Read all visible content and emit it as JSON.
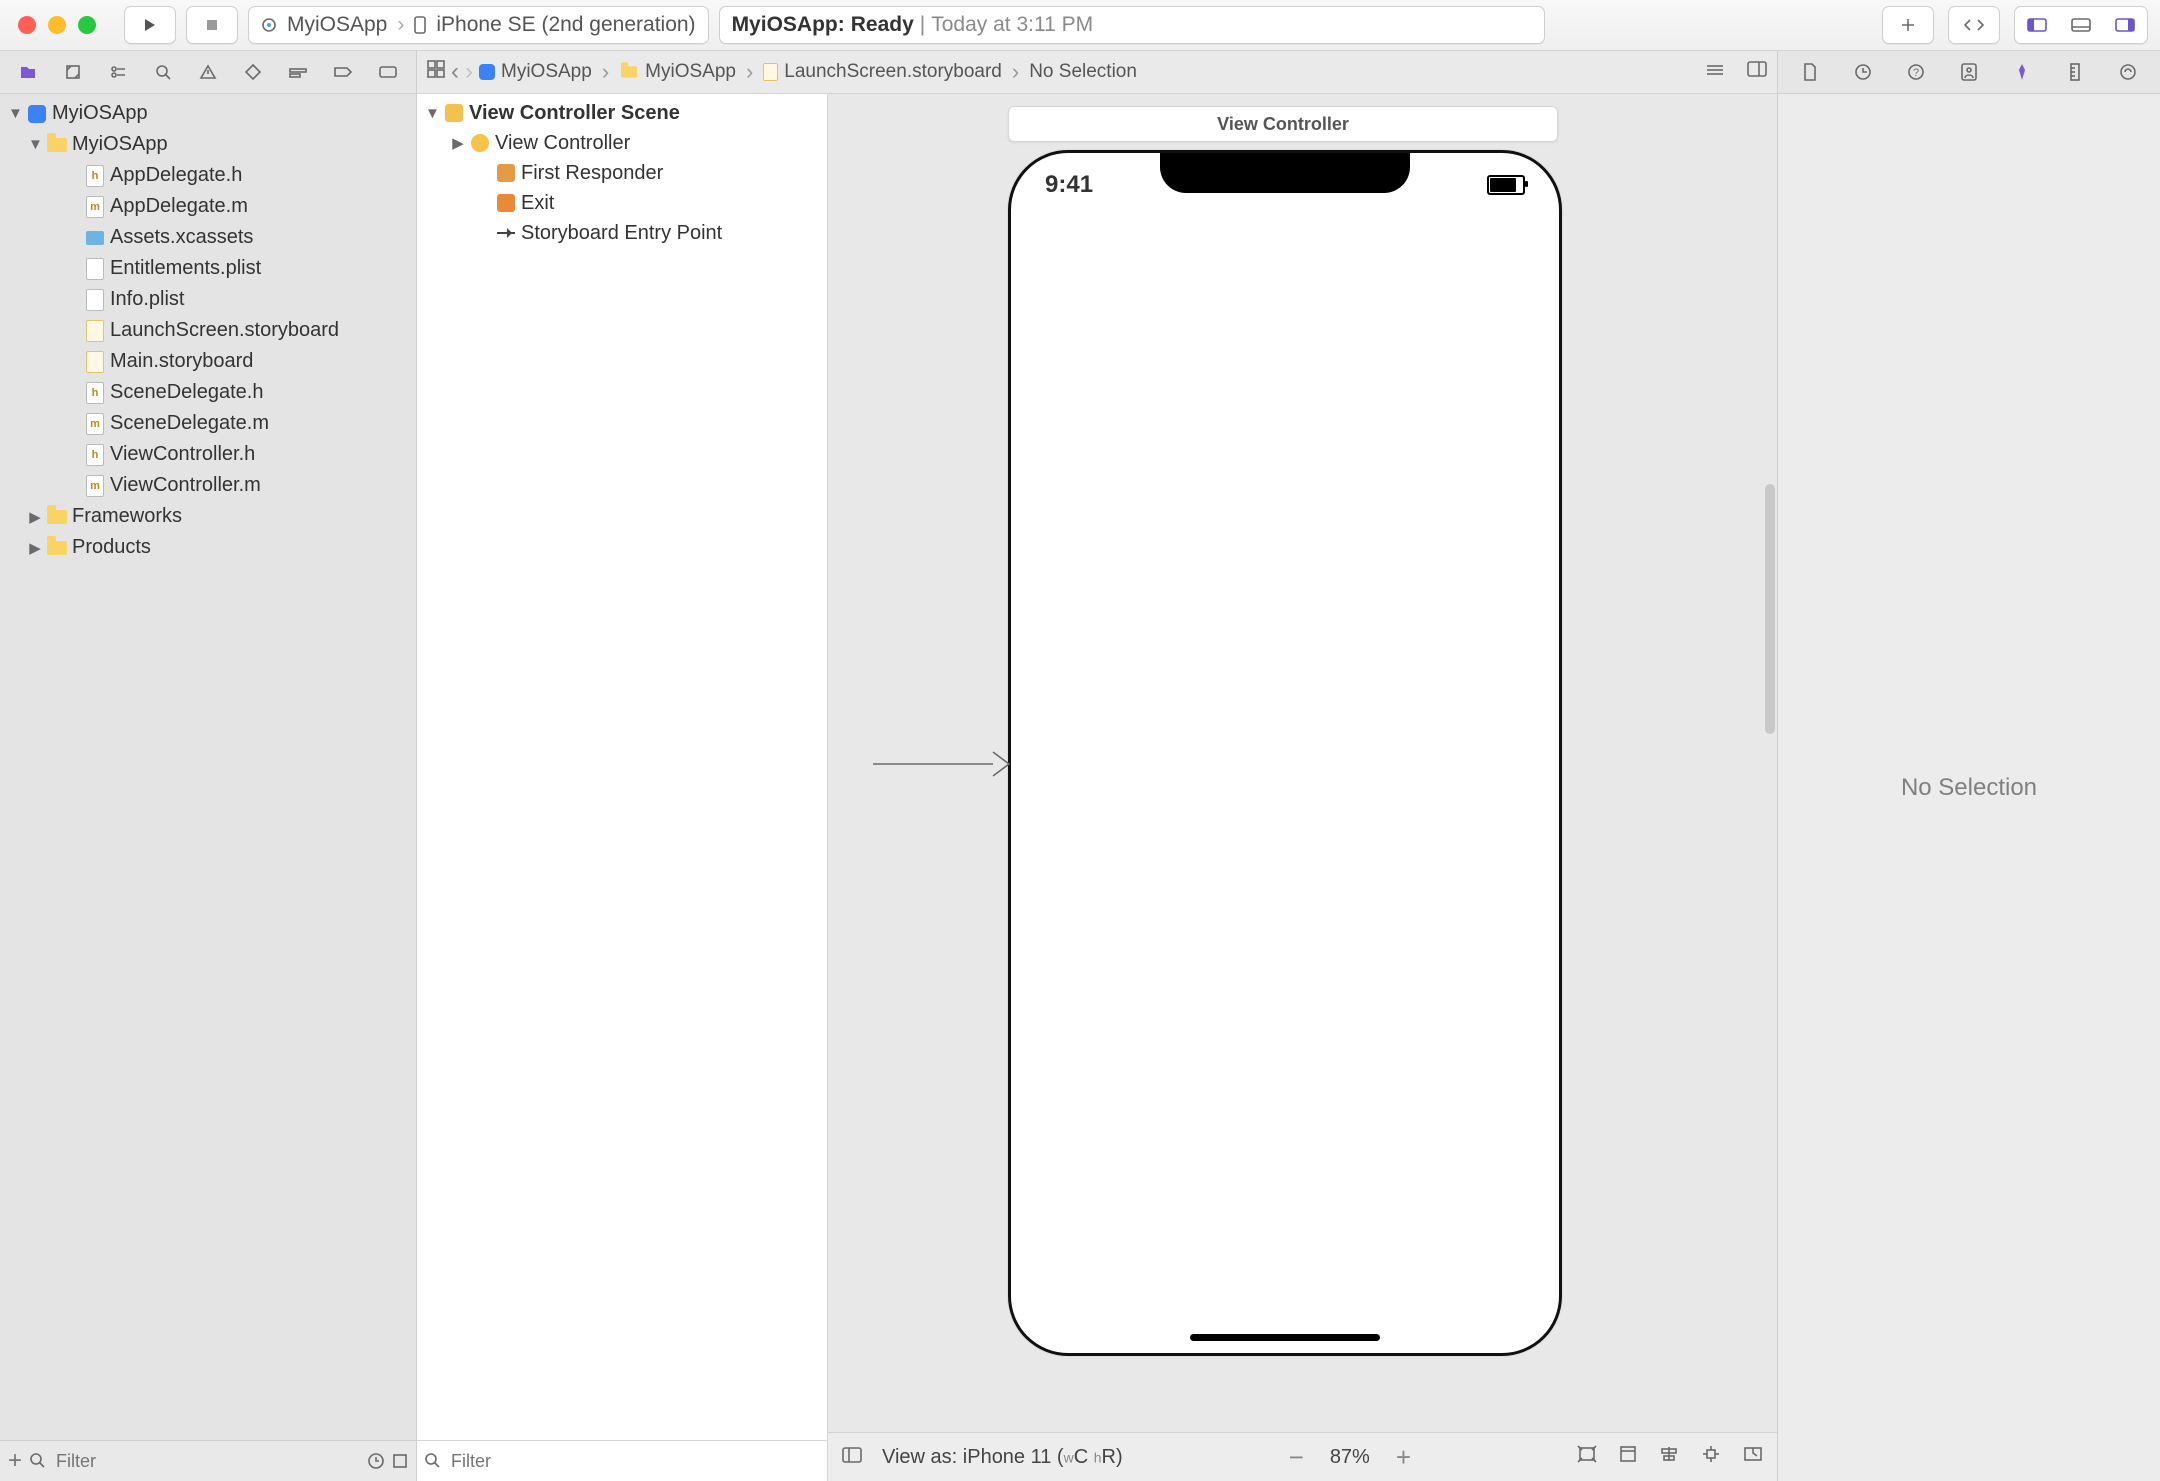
{
  "titlebar": {
    "scheme_name": "MyiOSApp",
    "destination": "iPhone SE (2nd generation)",
    "status_app": "MyiOSApp:",
    "status_state": "Ready",
    "status_sep": "|",
    "status_time": "Today at 3:11 PM"
  },
  "navigator": {
    "project_root": "MyiOSApp",
    "group_main": "MyiOSApp",
    "files": [
      "AppDelegate.h",
      "AppDelegate.m",
      "Assets.xcassets",
      "Entitlements.plist",
      "Info.plist",
      "LaunchScreen.storyboard",
      "Main.storyboard",
      "SceneDelegate.h",
      "SceneDelegate.m",
      "ViewController.h",
      "ViewController.m"
    ],
    "group_frameworks": "Frameworks",
    "group_products": "Products",
    "filter_placeholder": "Filter"
  },
  "jumpbar": {
    "crumbs": [
      "MyiOSApp",
      "MyiOSApp",
      "LaunchScreen.storyboard",
      "No Selection"
    ]
  },
  "outline": {
    "scene": "View Controller Scene",
    "view_controller": "View Controller",
    "first_responder": "First Responder",
    "exit": "Exit",
    "entry_point": "Storyboard Entry Point",
    "filter_placeholder": "Filter"
  },
  "canvas": {
    "vc_title": "View Controller",
    "phone_time": "9:41"
  },
  "canvas_footer": {
    "view_as": "View as: iPhone 11 (",
    "trait_c": "C",
    "trait_r": "R",
    "close": ")",
    "zoom": "87%"
  },
  "inspector": {
    "empty": "No Selection"
  }
}
